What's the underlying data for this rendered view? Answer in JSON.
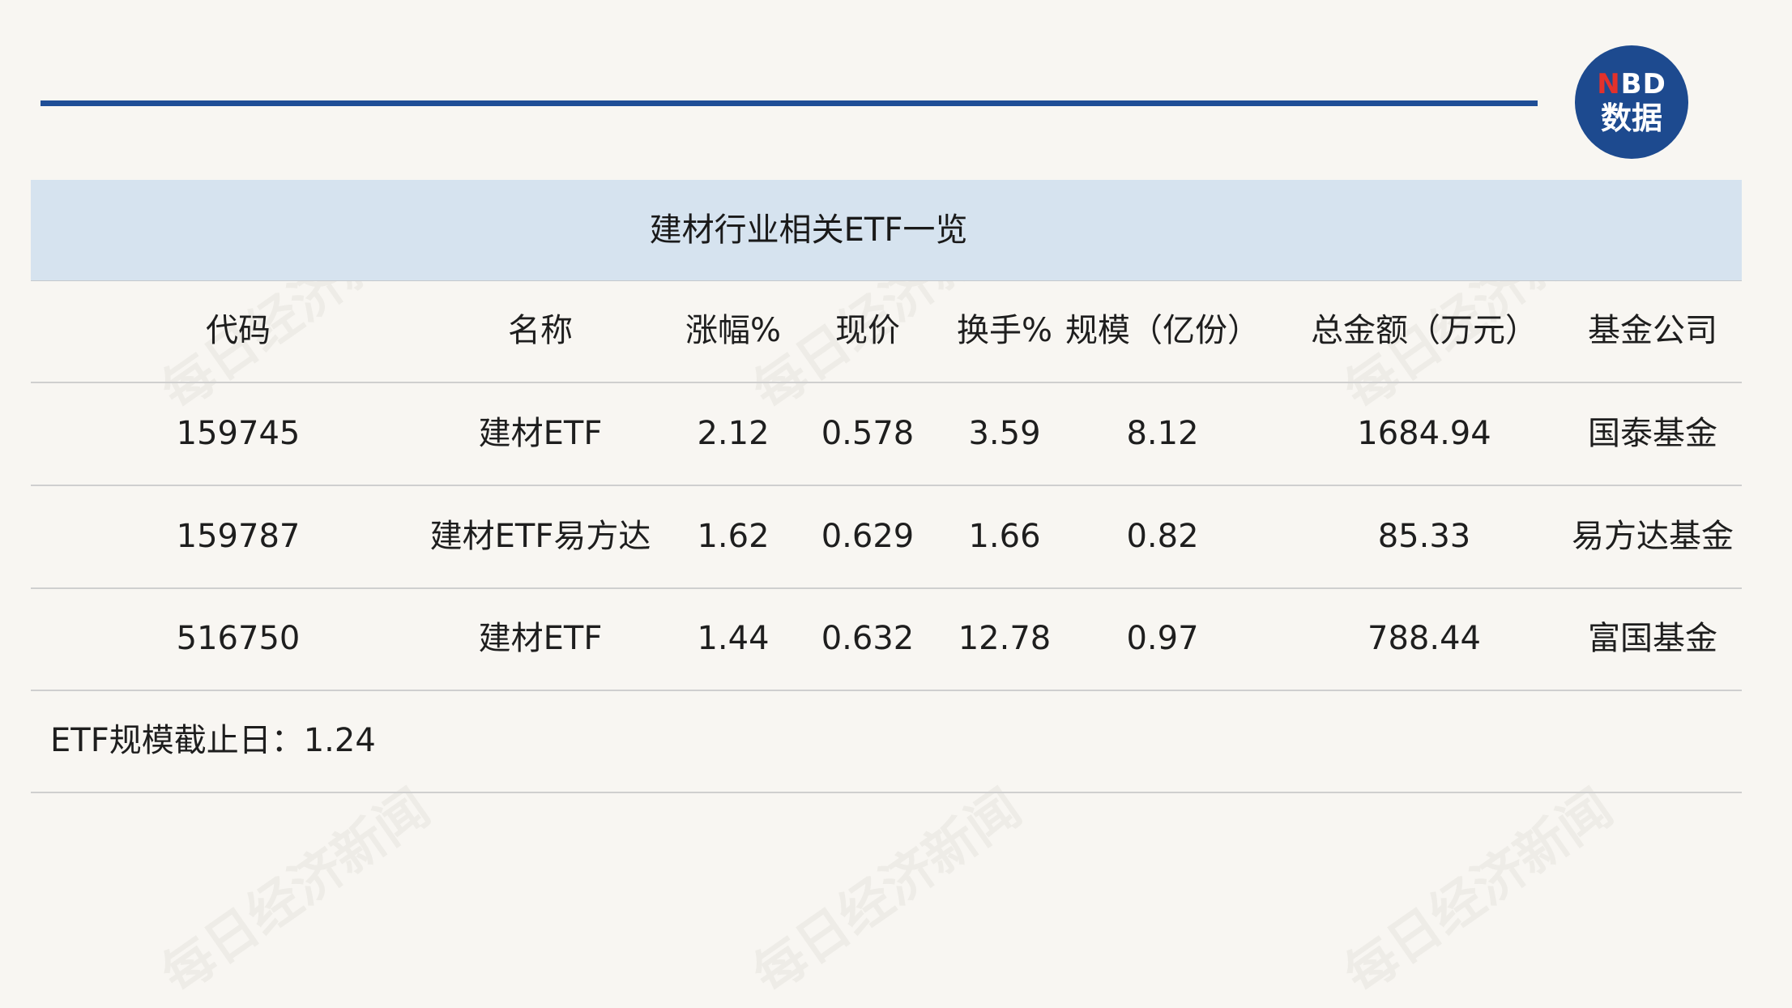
{
  "logo": {
    "top_initial": "N",
    "top_rest": "BD",
    "bottom": "数据"
  },
  "watermark_text": "每日经济新闻",
  "table": {
    "title": "建材行业相关ETF一览",
    "headers": [
      "代码",
      "名称",
      "涨幅%",
      "现价",
      "换手%",
      "规模（亿份）",
      "总金额（万元）",
      "基金公司"
    ],
    "rows": [
      [
        "159745",
        "建材ETF",
        "2.12",
        "0.578",
        "3.59",
        "8.12",
        "1684.94",
        "国泰基金"
      ],
      [
        "159787",
        "建材ETF易方达",
        "1.62",
        "0.629",
        "1.66",
        "0.82",
        "85.33",
        "易方达基金"
      ],
      [
        "516750",
        "建材ETF",
        "1.44",
        "0.632",
        "12.78",
        "0.97",
        "788.44",
        "富国基金"
      ]
    ],
    "note": "ETF规模截止日：1.24"
  },
  "colors": {
    "accent_blue": "#1f4e96",
    "title_band": "#d6e3ef",
    "logo_red": "#e2312b"
  }
}
